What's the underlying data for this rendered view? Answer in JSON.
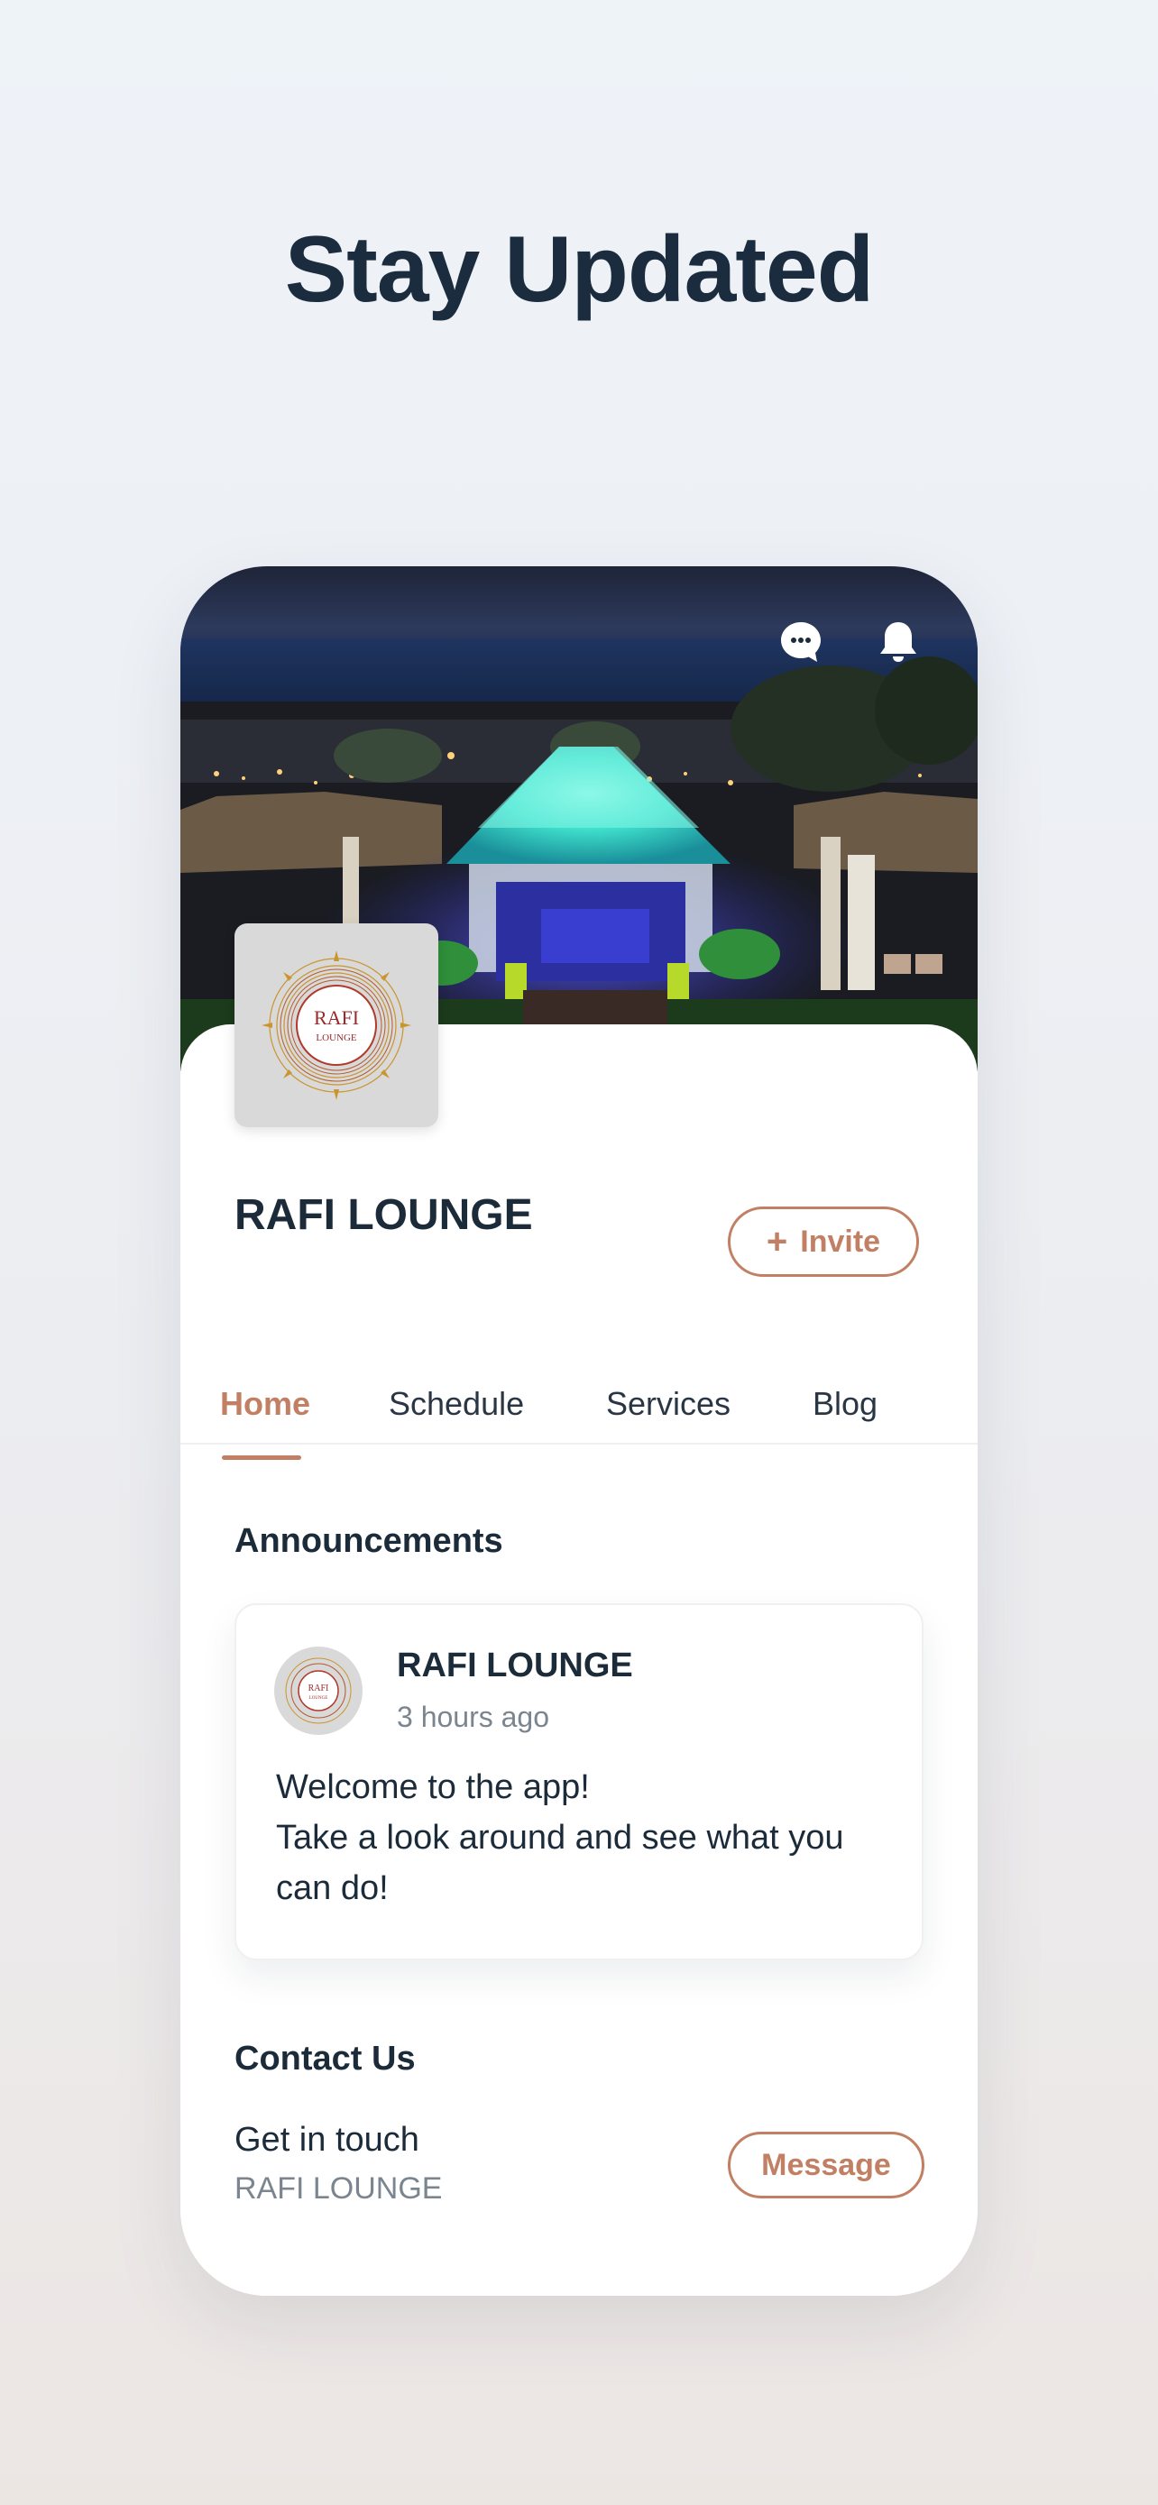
{
  "headline": "Stay Updated",
  "header": {
    "icons": [
      "chat-icon",
      "bell-icon"
    ]
  },
  "business": {
    "name": "RAFI LOUNGE",
    "logo_text_top": "RAFI",
    "logo_text_bottom": "LOUNGE",
    "invite_label": "Invite"
  },
  "tabs": [
    {
      "label": "Home",
      "active": true
    },
    {
      "label": "Schedule",
      "active": false
    },
    {
      "label": "Services",
      "active": false
    },
    {
      "label": "Blog",
      "active": false
    }
  ],
  "announcements": {
    "title": "Announcements",
    "post": {
      "author": "RAFI LOUNGE",
      "time": "3 hours ago",
      "lines": [
        "Welcome to the app!",
        "Take a look around and see what you",
        "can do!"
      ]
    }
  },
  "contact": {
    "title": "Contact Us",
    "subtitle": "Get in touch",
    "name": "RAFI LOUNGE",
    "message_label": "Message"
  },
  "colors": {
    "accent": "#c17f63",
    "text_dark": "#1c2b3a",
    "text_muted": "#7b8590"
  }
}
